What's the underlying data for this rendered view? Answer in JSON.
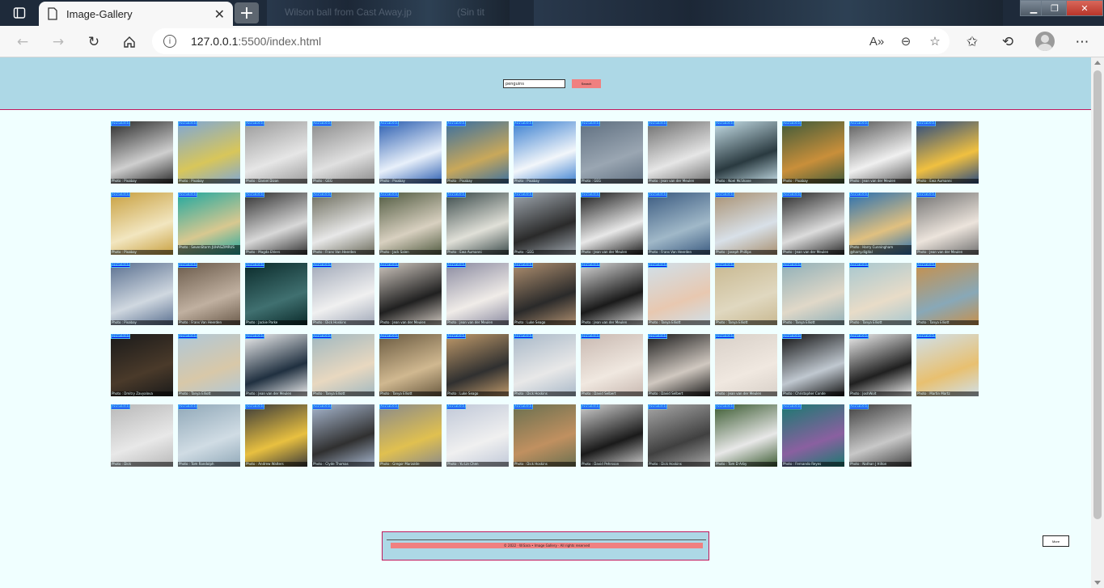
{
  "browser": {
    "tab_title": "Image-Gallery",
    "ghost_tabs": [
      "Wilson ball from Cast Away.jp",
      "(Sin tit"
    ],
    "url_host": "127.0.0.1",
    "url_path": ":5500/index.html",
    "icons": [
      "sidebar-icon",
      "document-icon",
      "close-icon",
      "plus-icon",
      "back-icon",
      "forward-icon",
      "refresh-icon",
      "home-icon",
      "info-icon",
      "read-aloud-icon",
      "zoom-out-icon",
      "add-favorite-icon",
      "favorites-icon",
      "history-icon",
      "profile-icon",
      "more-icon"
    ]
  },
  "header": {
    "search_value": "penguins",
    "search_button": "Search"
  },
  "gallery": {
    "download_label": "Download",
    "images": [
      {
        "credit": "Photo : Pixabay",
        "colors": [
          "#2b2b2b",
          "#cfcfcf"
        ]
      },
      {
        "credit": "Photo : Pixabay",
        "colors": [
          "#7fa7d6",
          "#d8c65a"
        ]
      },
      {
        "credit": "Photo : Daniel Dizon",
        "colors": [
          "#9a9a9a",
          "#e6e6e6"
        ]
      },
      {
        "credit": "Photo : GEG",
        "colors": [
          "#8a8a8a",
          "#e0e0e0"
        ]
      },
      {
        "credit": "Photo : Pixabay",
        "colors": [
          "#2a5db0",
          "#e8f0fa"
        ]
      },
      {
        "credit": "Photo : Pixabay",
        "colors": [
          "#3a6fa0",
          "#c9a85a"
        ]
      },
      {
        "credit": "Photo : Pixabay",
        "colors": [
          "#3a7fd0",
          "#f2f6fa"
        ]
      },
      {
        "credit": "Photo : GEG",
        "colors": [
          "#5f6f80",
          "#9aa6b2"
        ]
      },
      {
        "credit": "Photo : Jean van der Meulen",
        "colors": [
          "#6d6d6d",
          "#e6e6e6"
        ]
      },
      {
        "credit": "Photo : Noel McShane",
        "colors": [
          "#c6dfe8",
          "#2a3a40"
        ]
      },
      {
        "credit": "Photo : Pixabay",
        "colors": [
          "#3f5a3a",
          "#c98f3a"
        ]
      },
      {
        "credit": "Photo : Jean van der Meulen",
        "colors": [
          "#5a5a5a",
          "#f0f0f0"
        ]
      },
      {
        "credit": "Photo : Ewa Aumanni",
        "colors": [
          "#2a4a80",
          "#f0c040"
        ]
      },
      {
        "credit": "Photo : Pixabay",
        "colors": [
          "#c8a040",
          "#f2e6c0"
        ]
      },
      {
        "credit": "Photo : SevenStorm JUHASZIMRUS",
        "colors": [
          "#20a8a0",
          "#d8c890"
        ],
        "tall": true
      },
      {
        "credit": "Photo : Magda Ehlers",
        "colors": [
          "#303030",
          "#d8d8d8"
        ]
      },
      {
        "credit": "Photo : Frans Van Heerden",
        "colors": [
          "#6a6a5a",
          "#e8e8e8"
        ]
      },
      {
        "credit": "Photo : Jack Salen",
        "colors": [
          "#505a40",
          "#d8d0c0"
        ]
      },
      {
        "credit": "Photo : Ewa Aumanni",
        "colors": [
          "#3a4a4a",
          "#e0e0d8"
        ]
      },
      {
        "credit": "Photo : GEG",
        "colors": [
          "#a0a8b0",
          "#2a2a2a"
        ]
      },
      {
        "credit": "Photo : Jean van der Meulen",
        "colors": [
          "#1a1a1a",
          "#e8e8e8"
        ]
      },
      {
        "credit": "Photo : Frans Van Heerden",
        "colors": [
          "#3a5a80",
          "#a0b8c8"
        ]
      },
      {
        "credit": "Photo : Joseph Phillips",
        "colors": [
          "#a89070",
          "#d8e0e8"
        ]
      },
      {
        "credit": "Photo : Jean van der Meulen",
        "colors": [
          "#2a2a2a",
          "#dcdcdc"
        ]
      },
      {
        "credit": "Photo : Harry Cunningham @harry.digital",
        "colors": [
          "#2a70b0",
          "#e0c080"
        ],
        "tall": true
      },
      {
        "credit": "Photo : Jean van der Meulen",
        "colors": [
          "#707070",
          "#ece4dc"
        ]
      },
      {
        "credit": "Photo : Pixabay",
        "colors": [
          "#5a7090",
          "#d0d8e0"
        ]
      },
      {
        "credit": "Photo : Frans Van Heerden",
        "colors": [
          "#6a5a4a",
          "#c0b0a0"
        ]
      },
      {
        "credit": "Photo : Jackie Parke",
        "colors": [
          "#0a2a2a",
          "#407070"
        ]
      },
      {
        "credit": "Photo : Dick Hoskins",
        "colors": [
          "#a0a8b8",
          "#f0f0f0"
        ]
      },
      {
        "credit": "Photo : Jean van der Meulen",
        "colors": [
          "#d0c8c0",
          "#202020"
        ]
      },
      {
        "credit": "Photo : Jean van der Meulen",
        "colors": [
          "#8a8aa0",
          "#f0ece8"
        ]
      },
      {
        "credit": "Photo : Luke Seago",
        "colors": [
          "#b09070",
          "#2a2a2a"
        ]
      },
      {
        "credit": "Photo : Jean van der Meulen",
        "colors": [
          "#d8d8d8",
          "#1a1a1a"
        ]
      },
      {
        "credit": "Photo : Tanya Elliott",
        "colors": [
          "#d0e0ea",
          "#e8c8b0"
        ]
      },
      {
        "credit": "Photo : Tanya Elliott",
        "colors": [
          "#c8b890",
          "#e0d8c0"
        ]
      },
      {
        "credit": "Photo : Tanya Elliott",
        "colors": [
          "#90b0b8",
          "#e0d8c8"
        ]
      },
      {
        "credit": "Photo : Tanya Elliott",
        "colors": [
          "#a8c8d0",
          "#e8dcc8"
        ]
      },
      {
        "credit": "Photo : Tanya Elliott",
        "colors": [
          "#c8904a",
          "#88a8b8"
        ]
      },
      {
        "credit": "Photo : Dmitry Zavyalova",
        "colors": [
          "#1a1a1a",
          "#4a3a2a"
        ]
      },
      {
        "credit": "Photo : Tanya Elliott",
        "colors": [
          "#b0c8d8",
          "#d8c8a8"
        ]
      },
      {
        "credit": "Photo : Jean van der Meulen",
        "colors": [
          "#f0f0f0",
          "#203040"
        ]
      },
      {
        "credit": "Photo : Tanya Elliott",
        "colors": [
          "#a0b8c0",
          "#e8d8c0"
        ]
      },
      {
        "credit": "Photo : Tanya Elliott",
        "colors": [
          "#6a5a40",
          "#d0b890"
        ]
      },
      {
        "credit": "Photo : Luke Seago",
        "colors": [
          "#c09a6a",
          "#303030"
        ]
      },
      {
        "credit": "Photo : Dick Hoskins",
        "colors": [
          "#a8b8c8",
          "#e8e8e8"
        ]
      },
      {
        "credit": "Photo : David Selbert",
        "colors": [
          "#c8b8b0",
          "#f0e8e0"
        ]
      },
      {
        "credit": "Photo : David Selbert",
        "colors": [
          "#1a1a1a",
          "#d0c8c0"
        ]
      },
      {
        "credit": "Photo : Jean van der Meulen",
        "colors": [
          "#d8d0c8",
          "#f0e8e0"
        ]
      },
      {
        "credit": "Photo : Christopher Conde",
        "colors": [
          "#101010",
          "#c0c8d0"
        ]
      },
      {
        "credit": "Photo : JoshWolt",
        "colors": [
          "#f0f0f0",
          "#202020"
        ]
      },
      {
        "credit": "Photo : Martin Martz",
        "colors": [
          "#d0e0ea",
          "#e8c070"
        ]
      },
      {
        "credit": "Photo : Dick",
        "colors": [
          "#b8b8b8",
          "#e8e8e8"
        ]
      },
      {
        "credit": "Photo : Tom Randolph",
        "colors": [
          "#90a8b8",
          "#d0dce4"
        ]
      },
      {
        "credit": "Photo : Andrew Walters",
        "colors": [
          "#3a3a3a",
          "#e8c040"
        ]
      },
      {
        "credit": "Photo : Clyde Thomas",
        "colors": [
          "#a8b8d0",
          "#303030"
        ]
      },
      {
        "credit": "Photo : Gregor Marzolde",
        "colors": [
          "#8a8a8a",
          "#e0c050"
        ]
      },
      {
        "credit": "Photo : Yu Lin Chen",
        "colors": [
          "#c0c8d8",
          "#f0f0f0"
        ]
      },
      {
        "credit": "Photo : Dick Hoskins",
        "colors": [
          "#6a7050",
          "#c09060"
        ]
      },
      {
        "credit": "Photo : David Pehrsson",
        "colors": [
          "#d0d0d0",
          "#1a1a1a"
        ]
      },
      {
        "credit": "Photo : Dick Hoskins",
        "colors": [
          "#a8a8a8",
          "#404040"
        ]
      },
      {
        "credit": "Photo : Tom D Arby",
        "colors": [
          "#3a5a30",
          "#e8e8e8"
        ]
      },
      {
        "credit": "Photo : Fernando Reyes",
        "colors": [
          "#1a7a70",
          "#8a60a0"
        ]
      },
      {
        "credit": "Photo : Nathan J Hilton",
        "colors": [
          "#404040",
          "#c8c8c8"
        ]
      }
    ]
  },
  "footer": {
    "text": "© 2022 · W.Sara • Image Gallery · All rights reserved"
  },
  "more_button": "More"
}
